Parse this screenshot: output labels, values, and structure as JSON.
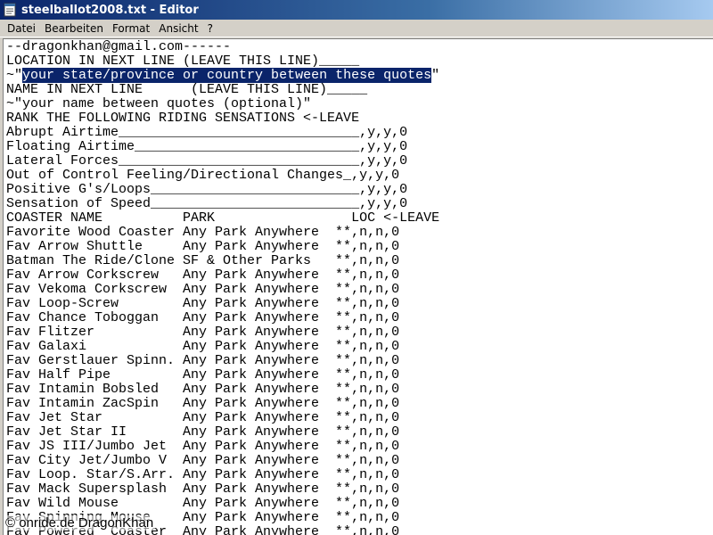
{
  "window": {
    "title": "steelballot2008.txt - Editor"
  },
  "menu": [
    {
      "label": "Datei"
    },
    {
      "label": "Bearbeiten"
    },
    {
      "label": "Format"
    },
    {
      "label": "Ansicht"
    },
    {
      "label": "?"
    }
  ],
  "editor": {
    "lines_before": "--dragonkhan@gmail.com------\nLOCATION IN NEXT LINE (LEAVE THIS LINE)_____",
    "sel_prefix": "~\"",
    "sel_text": "your state/province or country between these quotes",
    "sel_suffix": "\"",
    "lines_after": "NAME IN NEXT LINE      (LEAVE THIS LINE)_____\n~\"your name between quotes (optional)\"\nRANK THE FOLLOWING RIDING SENSATIONS <-LEAVE\nAbrupt Airtime______________________________,y,y,0\nFloating Airtime____________________________,y,y,0\nLateral Forces______________________________,y,y,0\nOut of Control Feeling/Directional Changes_,y,y,0\nPositive G's/Loops__________________________,y,y,0\nSensation of Speed__________________________,y,y,0\nCOASTER NAME          PARK                 LOC <-LEAVE\nFavorite Wood Coaster Any Park Anywhere  **,n,n,0\nFav Arrow Shuttle     Any Park Anywhere  **,n,n,0\nBatman The Ride/Clone SF & Other Parks   **,n,n,0\nFav Arrow Corkscrew   Any Park Anywhere  **,n,n,0\nFav Vekoma Corkscrew  Any Park Anywhere  **,n,n,0\nFav Loop-Screw        Any Park Anywhere  **,n,n,0\nFav Chance Toboggan   Any Park Anywhere  **,n,n,0\nFav Flitzer           Any Park Anywhere  **,n,n,0\nFav Galaxi            Any Park Anywhere  **,n,n,0\nFav Gerstlauer Spinn. Any Park Anywhere  **,n,n,0\nFav Half Pipe         Any Park Anywhere  **,n,n,0\nFav Intamin Bobsled   Any Park Anywhere  **,n,n,0\nFav Intamin ZacSpin   Any Park Anywhere  **,n,n,0\nFav Jet Star          Any Park Anywhere  **,n,n,0\nFav Jet Star II       Any Park Anywhere  **,n,n,0\nFav JS III/Jumbo Jet  Any Park Anywhere  **,n,n,0\nFav City Jet/Jumbo V  Any Park Anywhere  **,n,n,0\nFav Loop. Star/S.Arr. Any Park Anywhere  **,n,n,0\nFav Mack Supersplash  Any Park Anywhere  **,n,n,0\nFav Wild Mouse        Any Park Anywhere  **,n,n,0\nFav Spinning Mouse    Any Park Anywhere  **,n,n,0\nFav Powered  Coaster  Any Park Anywhere  **,n,n,0"
  },
  "watermark": {
    "text": "© onride.de  DragonKhan"
  },
  "colors": {
    "titlebar_start": "#0a246a",
    "titlebar_end": "#a6caf0",
    "selection": "#0a246a",
    "chrome": "#d4d0c8"
  }
}
